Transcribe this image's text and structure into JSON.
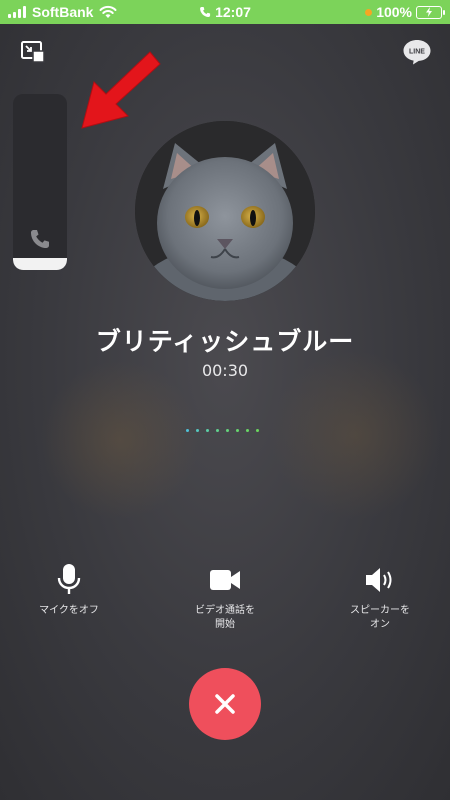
{
  "status_bar": {
    "carrier": "SoftBank",
    "time": "12:07",
    "battery": "100%"
  },
  "top_bar": {
    "minimize_icon": "picture-in-picture-icon",
    "logo_text": "LINE"
  },
  "mini_call_panel": {
    "icon": "phone-icon"
  },
  "caller": {
    "name": "ブリティッシュブルー",
    "duration": "00:30"
  },
  "connection_dots": [
    "#4fc3d8",
    "#55c9c0",
    "#5bcfa6",
    "#60d38e",
    "#63d57c",
    "#66d76e",
    "#68d866",
    "#6ad95e"
  ],
  "controls": [
    {
      "id": "mute",
      "icon": "microphone-icon",
      "label": "マイクをオフ"
    },
    {
      "id": "video",
      "icon": "video-camera-icon",
      "label": "ビデオ通話を\n開始"
    },
    {
      "id": "speaker",
      "icon": "speaker-icon",
      "label": "スピーカーを\nオン"
    }
  ],
  "end_call": {
    "icon": "close-icon",
    "color": "#ef4f5c"
  },
  "colors": {
    "status_bar": "#7cd35a",
    "arrow": "#e3151b"
  }
}
